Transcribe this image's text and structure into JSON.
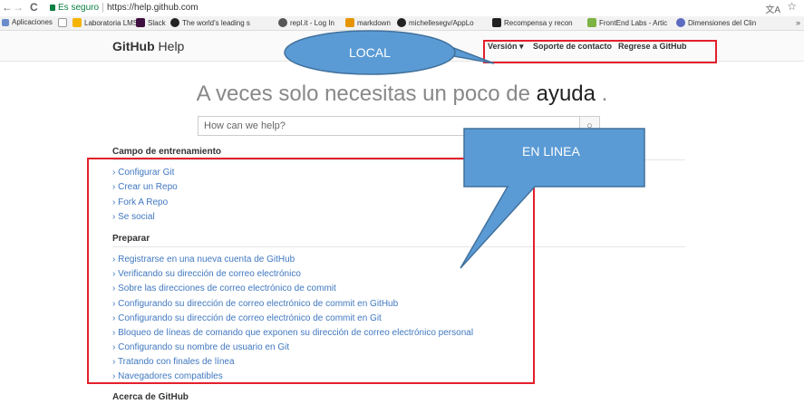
{
  "browser": {
    "back": "←",
    "forward": "→",
    "reload": "C",
    "secure_label": "Es seguro",
    "url": "https://help.github.com",
    "translate_icon": "translate-icon",
    "star_icon": "star-icon"
  },
  "bookmarks": [
    {
      "label": "Aplicaciones",
      "color": "#6b8ccb"
    },
    {
      "label": "",
      "color": "#ffffff"
    },
    {
      "label": "Laboratoria LMS",
      "color": "#f4b400"
    },
    {
      "label": "Slack",
      "color": "#3f0e40"
    },
    {
      "label": "The world's leading s",
      "color": "#222222"
    },
    {
      "label": "repl.it - Log In",
      "color": "#555555"
    },
    {
      "label": "markdown",
      "color": "#e69500"
    },
    {
      "label": "michellesegv/AppLo",
      "color": "#222222"
    },
    {
      "label": "Recompensa y recon",
      "color": "#222222"
    },
    {
      "label": "FrontEnd Labs - Artic",
      "color": "#7cb342"
    },
    {
      "label": "Dimensiones del Clin",
      "color": "#5c6bc0"
    }
  ],
  "header": {
    "logo_bold": "GitHub",
    "logo_light": "Help",
    "nav": [
      "Versión ▾",
      "Soporte de contacto",
      "Regrese a GitHub"
    ]
  },
  "annotations": {
    "local": "LOCAL",
    "online": "EN LINEA"
  },
  "hero": {
    "prefix": "A veces solo necesitas un poco de",
    "highlight": "ayuda",
    "suffix": "."
  },
  "search": {
    "placeholder": "How can we help?"
  },
  "sections": [
    {
      "title": "Campo de entrenamiento",
      "links": [
        "Configurar Git",
        "Crear un Repo",
        "Fork A Repo",
        "Se social"
      ]
    },
    {
      "title": "Preparar",
      "links": [
        "Registrarse en una nueva cuenta de GitHub",
        "Verificando su dirección de correo electrónico",
        "Sobre las direcciones de correo electrónico de commit",
        "Configurando su dirección de correo electrónico de commit en GitHub",
        "Configurando su dirección de correo electrónico de commit en Git",
        "Bloqueo de líneas de comando que exponen su dirección de correo electrónico personal",
        "Configurando su nombre de usuario en Git",
        "Tratando con finales de línea",
        "Navegadores compatibles"
      ]
    },
    {
      "title": "Acerca de GitHub",
      "links": []
    }
  ],
  "colors": {
    "annotation_fill": "#5b9bd5",
    "annotation_stroke": "#41719c",
    "highlight_border": "#e3202b",
    "link": "#4078c0"
  }
}
